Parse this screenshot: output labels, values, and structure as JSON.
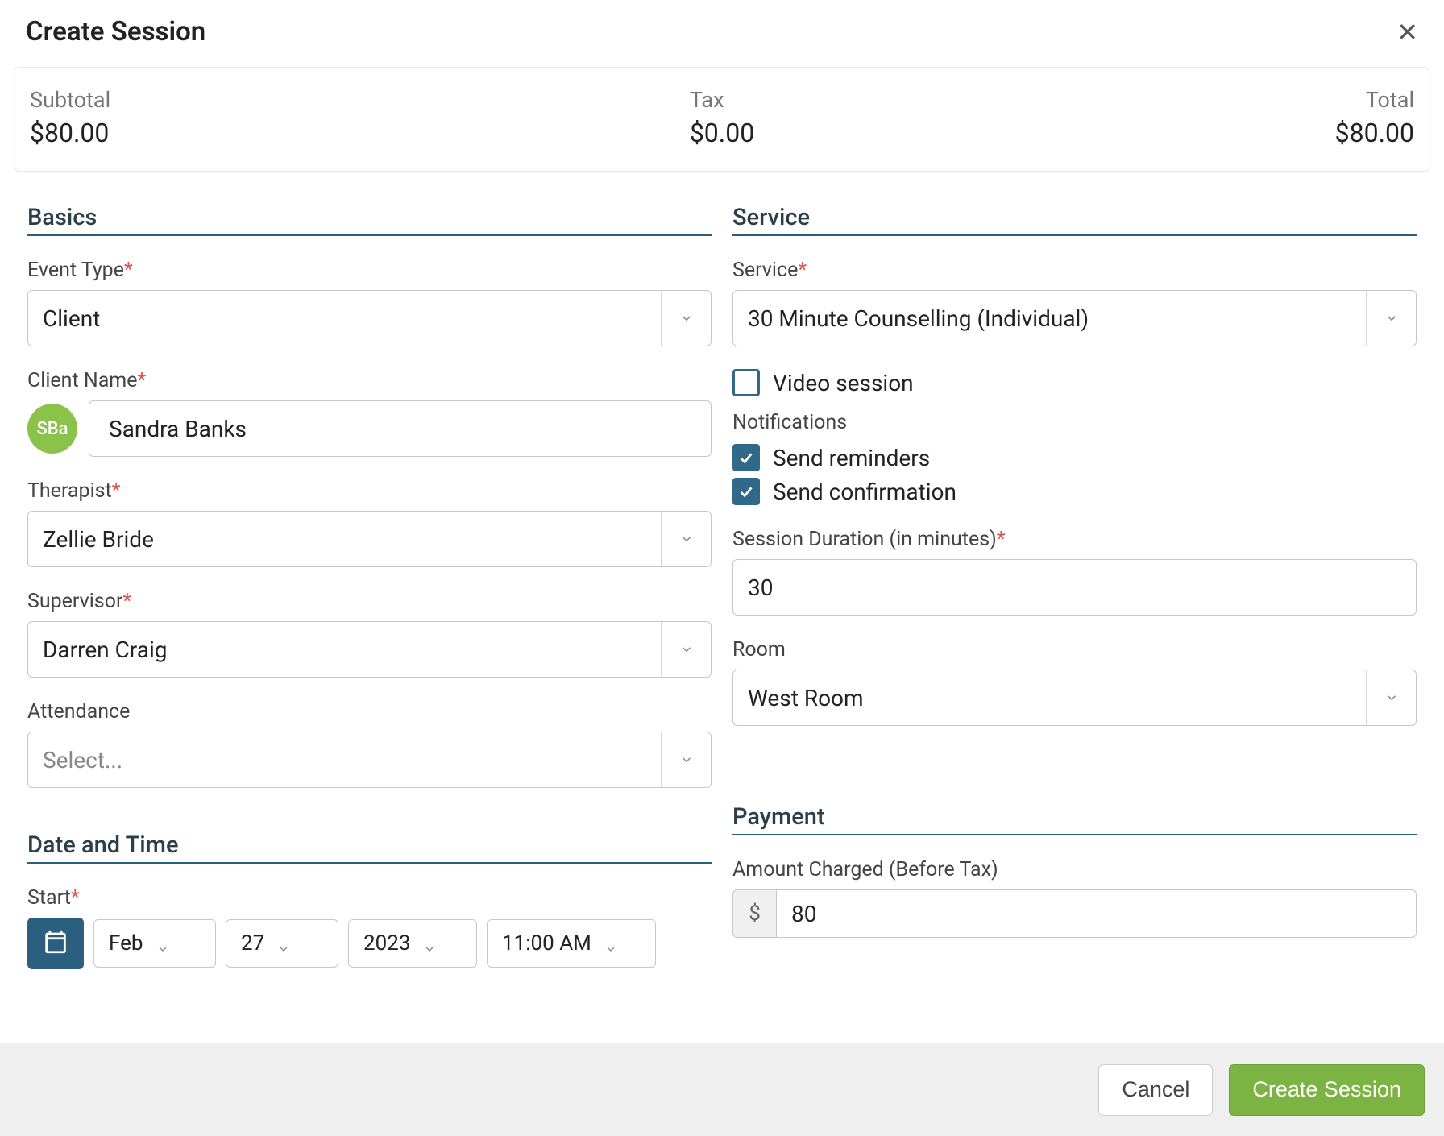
{
  "dialog": {
    "title": "Create Session",
    "close_label": "Close"
  },
  "summary": {
    "subtotal_label": "Subtotal",
    "subtotal_value": "$80.00",
    "tax_label": "Tax",
    "tax_value": "$0.00",
    "total_label": "Total",
    "total_value": "$80.00"
  },
  "basics": {
    "heading": "Basics",
    "event_type_label": "Event Type",
    "event_type_value": "Client",
    "client_name_label": "Client Name",
    "client_avatar_initials": "SBa",
    "client_name_value": "Sandra Banks",
    "therapist_label": "Therapist",
    "therapist_value": "Zellie Bride",
    "supervisor_label": "Supervisor",
    "supervisor_value": "Darren Craig",
    "attendance_label": "Attendance",
    "attendance_placeholder": "Select..."
  },
  "service": {
    "heading": "Service",
    "service_label": "Service",
    "service_value": "30 Minute Counselling (Individual)",
    "video_session_label": "Video session",
    "video_session_checked": false,
    "notifications_heading": "Notifications",
    "send_reminders_label": "Send reminders",
    "send_reminders_checked": true,
    "send_confirmation_label": "Send confirmation",
    "send_confirmation_checked": true,
    "duration_label": "Session Duration (in minutes)",
    "duration_value": "30",
    "room_label": "Room",
    "room_value": "West Room"
  },
  "datetime": {
    "heading": "Date and Time",
    "start_label": "Start",
    "month_value": "Feb",
    "day_value": "27",
    "year_value": "2023",
    "time_value": "11:00 AM"
  },
  "payment": {
    "heading": "Payment",
    "amount_label": "Amount Charged (Before Tax)",
    "currency_symbol": "$",
    "amount_value": "80"
  },
  "footer": {
    "cancel_label": "Cancel",
    "submit_label": "Create Session"
  }
}
